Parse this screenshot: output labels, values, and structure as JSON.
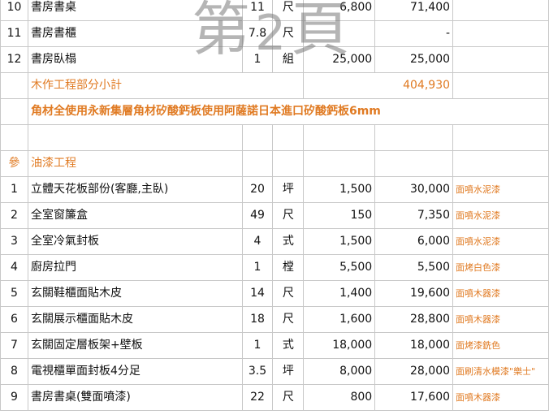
{
  "watermark": {
    "prefix": "第",
    "digit": "2",
    "suffix": "頁"
  },
  "rows_top": [
    {
      "num": "10",
      "item": "書房書桌",
      "qty": "11",
      "unit": "尺",
      "price": "6,800",
      "total": "71,400"
    },
    {
      "num": "11",
      "item": "書房書櫃",
      "qty": "7.8",
      "unit": "尺",
      "price": "",
      "total": "-"
    },
    {
      "num": "12",
      "item": "書房臥榻",
      "qty": "1",
      "unit": "組",
      "price": "25,000",
      "total": "25,000"
    }
  ],
  "subtotal": {
    "label": "木作工程部分小計",
    "value": "404,930"
  },
  "material_note": "角材全使用永新集層角材矽酸鈣板使用阿薩諾日本進口矽酸鈣板6mm",
  "section": {
    "num": "參",
    "title": "油漆工程"
  },
  "rows_paint": [
    {
      "num": "1",
      "item": "立體天花板部份(客廳,主臥)",
      "qty": "20",
      "unit": "坪",
      "price": "1,500",
      "total": "30,000",
      "note": "面噴水泥漆"
    },
    {
      "num": "2",
      "item": "全室窗簾盒",
      "qty": "49",
      "unit": "尺",
      "price": "150",
      "total": "7,350",
      "note": "面噴水泥漆"
    },
    {
      "num": "3",
      "item": "全室冷氣封板",
      "qty": "4",
      "unit": "式",
      "price": "1,500",
      "total": "6,000",
      "note": "面噴水泥漆"
    },
    {
      "num": "4",
      "item": "廚房拉門",
      "qty": "1",
      "unit": "樘",
      "price": "5,500",
      "total": "5,500",
      "note": "面烤白色漆"
    },
    {
      "num": "5",
      "item": "玄關鞋櫃面貼木皮",
      "qty": "14",
      "unit": "尺",
      "price": "1,400",
      "total": "19,600",
      "note": "面噴木器漆"
    },
    {
      "num": "6",
      "item": "玄關展示櫃面貼木皮",
      "qty": "18",
      "unit": "尺",
      "price": "1,600",
      "total": "28,800",
      "note": "面噴木器漆"
    },
    {
      "num": "7",
      "item": "玄關固定層板架+壁板",
      "qty": "1",
      "unit": "式",
      "price": "18,000",
      "total": "18,000",
      "note": "面烤漆銑色"
    },
    {
      "num": "8",
      "item": "電視櫃單面封板4分足",
      "qty": "3.5",
      "unit": "坪",
      "price": "8,000",
      "total": "28,000",
      "note": "面刷清水模漆\"樂士\""
    },
    {
      "num": "9",
      "item": "書房書桌(雙面噴漆)",
      "qty": "22",
      "unit": "尺",
      "price": "800",
      "total": "17,600",
      "note": "面噴木器漆"
    }
  ]
}
